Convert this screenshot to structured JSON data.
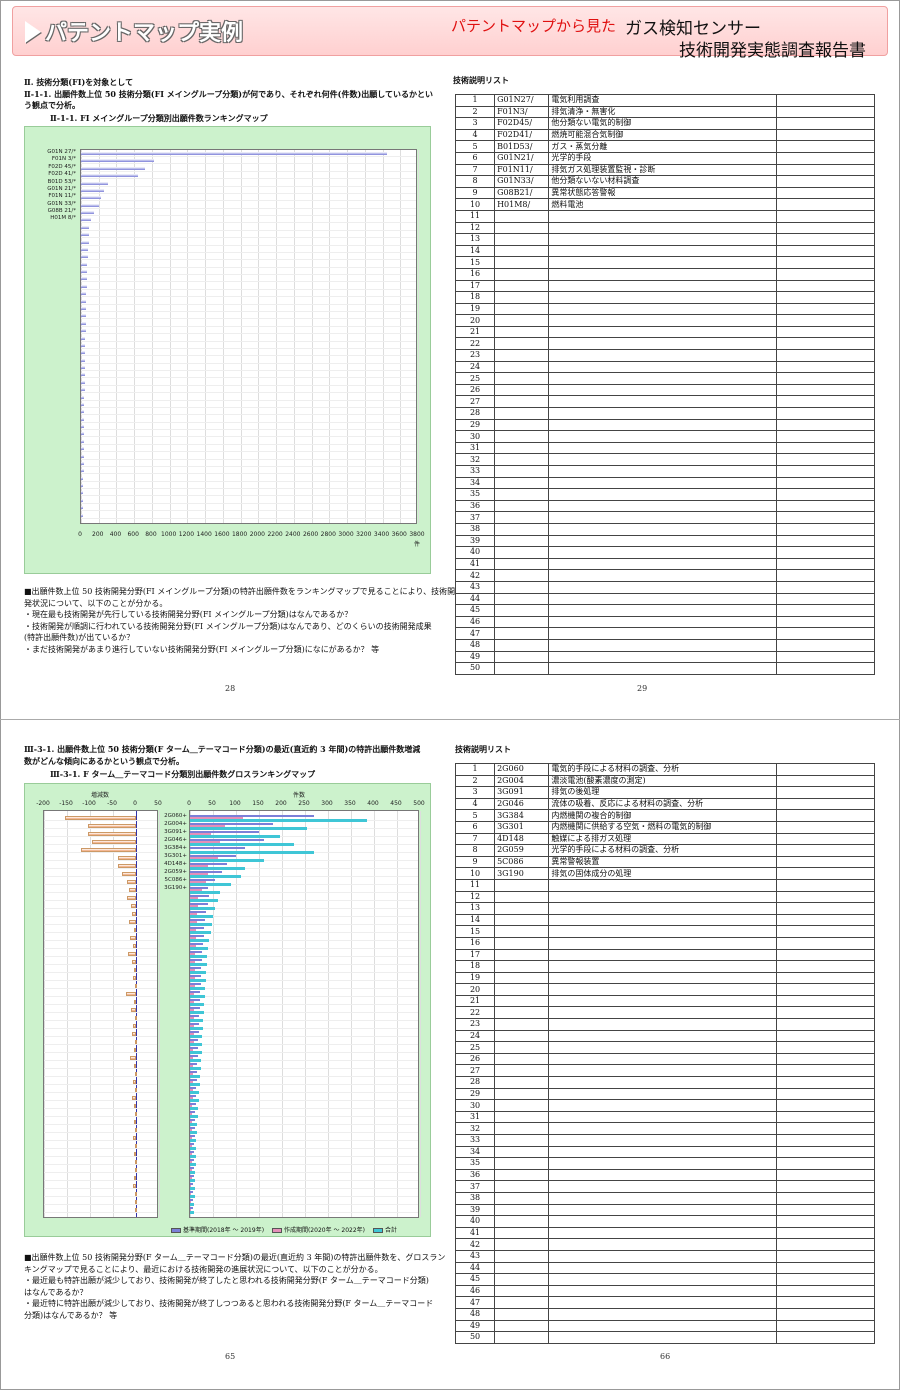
{
  "banner": {
    "title": "パテントマップ実例",
    "subtitle": "パテントマップから見た",
    "product": "ガス検知センサー",
    "report": "技術開発実態調査報告書"
  },
  "top": {
    "heading1": "Ⅱ. 技術分類(FI)を対象として",
    "heading2a": "Ⅱ-1-1. 出願件数上位 50 技術分類(FI メイングループ分類)が何であり、それぞれ何件(件数)出願しているかとい",
    "heading2b": "う観点で分析。",
    "chart_title": "Ⅱ-1-1. FI メイングループ分類別出願件数ランキングマップ",
    "desc": [
      "■出願件数上位 50 技術開発分野(FI メイングループ分類)の特許出願件数をランキングマップで見ることにより、技術開",
      "  発状況について、以下のことが分かる。",
      "    ・現在最も技術開発が先行している技術開発分野(FI メイングループ分類)はなんであるか？",
      "    ・技術開発が順調に行われている技術開発分野(FI メイングループ分類)はなんであり、どのくらいの技術開発成果",
      "      (特許出願件数)が出ているか？",
      "    ・まだ技術開発があまり進行していない技術開発分野(FI メイングループ分類)になにがあるか？     等"
    ],
    "page_left": "28",
    "page_right": "29",
    "list_title": "技術説明リスト",
    "list": [
      [
        "1",
        "G01N27/",
        "電気利用調査"
      ],
      [
        "2",
        "F01N3/",
        "排気清浄・無害化"
      ],
      [
        "3",
        "F02D45/",
        "他分類ない電気的制御"
      ],
      [
        "4",
        "F02D41/",
        "燃焼可能混合気制御"
      ],
      [
        "5",
        "B01D53/",
        "ガス・蒸気分離"
      ],
      [
        "6",
        "G01N21/",
        "光学的手段"
      ],
      [
        "7",
        "F01N11/",
        "排気ガス処理装置監視・診断"
      ],
      [
        "8",
        "G01N33/",
        "他分類ないない材料調査"
      ],
      [
        "9",
        "G08B21/",
        "異常状態応答警報"
      ],
      [
        "10",
        "H01M8/",
        "燃料電池"
      ]
    ]
  },
  "bottom": {
    "heading1a": "Ⅲ-3-1. 出願件数上位 50 技術分類(F ターム＿テーマコード分類)の最近(直近約 3 年間)の特許出願件数増減",
    "heading1b": "数がどんな傾向にあるかという観点で分析。",
    "chart_title": "Ⅲ-3-1. F ターム＿テーマコード分類別出願件数グロスランキングマップ",
    "desc": [
      "■出願件数上位 50 技術開発分野(F ターム＿テーマコード分類)の最近(直近約 3 年間)の特許出願件数を、グロスラン",
      "  キングマップで見ることにより、最近における技術開発の進展状況について、以下のことが分かる。",
      "    ・最近最も特許出願が減少しており、技術開発が終了したと思われる技術開発分野(F ターム＿テーマコード分類)",
      "      はなんであるか？",
      "    ・最近特に特許出願が減少しており、技術開発が終了しつつあると思われる技術開発分野(F ターム＿テーマコード",
      "      分類)はなんであるか？     等"
    ],
    "page_left": "65",
    "page_right": "66",
    "list_title": "技術説明リスト",
    "list": [
      [
        "1",
        "2G060",
        "電気的手段による材料の調査、分析"
      ],
      [
        "2",
        "2G004",
        "濃淡電池(酸素濃度の測定)"
      ],
      [
        "3",
        "3G091",
        "排気の後処理"
      ],
      [
        "4",
        "2G046",
        "流体の吸着、反応による材料の調査、分析"
      ],
      [
        "5",
        "3G384",
        "内燃機関の複合的制御"
      ],
      [
        "6",
        "3G301",
        "内燃機関に供給する空気・燃料の電気的制御"
      ],
      [
        "7",
        "4D148",
        "触媒による排ガス処理"
      ],
      [
        "8",
        "2G059",
        "光学的手段による材料の調査、分析"
      ],
      [
        "9",
        "5C086",
        "異常警報装置"
      ],
      [
        "10",
        "3G190",
        "排気の固体成分の処理"
      ]
    ],
    "legend": [
      "基準期間(2018年 ～ 2019年)",
      "作成期間(2020年 ～ 2022年)",
      "合計"
    ]
  },
  "colors": {
    "bar_blue": "#7b7fd8",
    "bar_pink": "#e58fb8",
    "bar_cyan": "#3fc6d6",
    "bar_orange": "#f0a070",
    "chart_bg": "#ccf2cc"
  },
  "chart_data": [
    {
      "type": "bar",
      "orientation": "horizontal",
      "categories": [
        "G01N 27/*",
        "F01N 3/*",
        "F02D 45/*",
        "F02D 41/*",
        "B01D 53/*",
        "G01N 21/*",
        "F01N 11/*",
        "G01N 33/*",
        "G08B 21/*",
        "H01M 8/*"
      ],
      "values": [
        3450,
        820,
        720,
        640,
        300,
        260,
        230,
        200,
        150,
        110
      ],
      "other_values": [
        95,
        90,
        85,
        80,
        75,
        72,
        70,
        68,
        65,
        62,
        60,
        58,
        56,
        54,
        52,
        50,
        48,
        47,
        46,
        45,
        44,
        42,
        40,
        39,
        38,
        37,
        36,
        35,
        34,
        33,
        32,
        31,
        30,
        29,
        28,
        27,
        26,
        25,
        24,
        23
      ],
      "xlim": [
        0,
        3800
      ],
      "xticks": [
        "0",
        "200",
        "400",
        "600",
        "800",
        "1000",
        "1200",
        "1400",
        "1600",
        "1800",
        "2000",
        "2200",
        "2400",
        "2600",
        "2800",
        "3000",
        "3200",
        "3400",
        "3600",
        "3800"
      ],
      "xunit": "件"
    },
    {
      "type": "bar",
      "orientation": "horizontal",
      "categories": [
        "2G060+",
        "2G004+",
        "3G091+",
        "2G046+",
        "3G384+",
        "3G301+",
        "4D148+",
        "2G059+",
        "5C086+",
        "3G190+"
      ],
      "left_label": "増減数",
      "left_xlim": [
        -200,
        50
      ],
      "left_xticks": [
        "-200",
        "-150",
        "-100",
        "-50",
        "0",
        "50"
      ],
      "right_label": "件数",
      "right_xlim": [
        0,
        500
      ],
      "right_xticks": [
        "0",
        "50",
        "100",
        "150",
        "200",
        "250",
        "300",
        "350",
        "400",
        "450",
        "500"
      ],
      "delta": [
        -155,
        -105,
        -105,
        -95,
        -120,
        -40,
        -40,
        -30,
        -20,
        -15
      ],
      "base": [
        270,
        180,
        150,
        160,
        120,
        100,
        80,
        70,
        55,
        40
      ],
      "current": [
        115,
        75,
        45,
        65,
        0,
        60,
        40,
        40,
        35,
        25
      ],
      "total": [
        385,
        255,
        195,
        225,
        270,
        160,
        120,
        110,
        90,
        65
      ]
    }
  ]
}
